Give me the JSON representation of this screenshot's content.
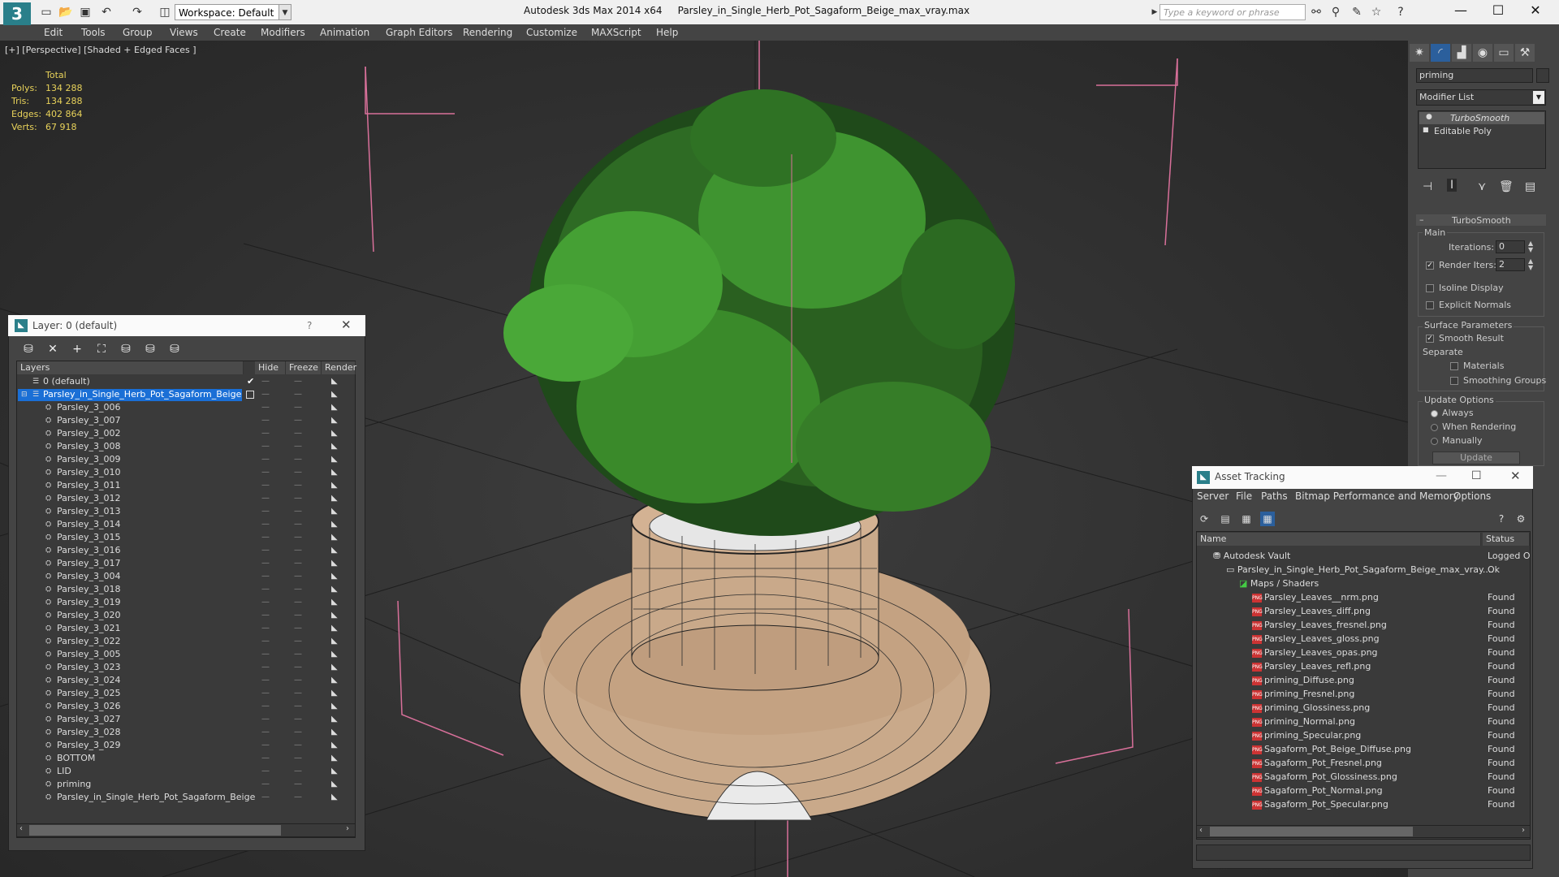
{
  "titlebar": {
    "workspace": "Workspace: Default",
    "app_title": "Autodesk 3ds Max  2014 x64",
    "file_title": "Parsley_in_Single_Herb_Pot_Sagaform_Beige_max_vray.max",
    "search_placeholder": "Type a keyword or phrase"
  },
  "menu": [
    "Edit",
    "Tools",
    "Group",
    "Views",
    "Create",
    "Modifiers",
    "Animation",
    "Graph Editors",
    "Rendering",
    "Customize",
    "MAXScript",
    "Help"
  ],
  "viewport": {
    "label": "[+] [Perspective] [Shaded + Edged Faces ]",
    "stats": {
      "total_label": "Total",
      "rows": [
        {
          "label": "Polys:",
          "value": "134 288"
        },
        {
          "label": "Tris:",
          "value": "134 288"
        },
        {
          "label": "Edges:",
          "value": "402 864"
        },
        {
          "label": "Verts:",
          "value": "67 918"
        }
      ]
    }
  },
  "command_panel": {
    "object_name": "priming",
    "modifier_list": "Modifier List",
    "stack": [
      "TurboSmooth",
      "Editable Poly"
    ],
    "rollout_title": "TurboSmooth",
    "main_label": "Main",
    "iterations_label": "Iterations:",
    "iterations_value": "0",
    "render_iters_label": "Render Iters:",
    "render_iters_value": "2",
    "isoline_label": "Isoline Display",
    "explicit_normals_label": "Explicit Normals",
    "surface_params_label": "Surface Parameters",
    "smooth_result_label": "Smooth Result",
    "separate_label": "Separate",
    "materials_label": "Materials",
    "smoothing_groups_label": "Smoothing Groups",
    "update_options_label": "Update Options",
    "always_label": "Always",
    "when_rendering_label": "When Rendering",
    "manually_label": "Manually",
    "update_button": "Update"
  },
  "layer_window": {
    "title": "Layer: 0 (default)",
    "help": "?",
    "columns": [
      "Layers",
      "Hide",
      "Freeze",
      "Render"
    ],
    "default_layer": "0 (default)",
    "selected_layer": "Parsley_in_Single_Herb_Pot_Sagaform_Beige",
    "objects": [
      "Parsley_3_006",
      "Parsley_3_007",
      "Parsley_3_002",
      "Parsley_3_008",
      "Parsley_3_009",
      "Parsley_3_010",
      "Parsley_3_011",
      "Parsley_3_012",
      "Parsley_3_013",
      "Parsley_3_014",
      "Parsley_3_015",
      "Parsley_3_016",
      "Parsley_3_017",
      "Parsley_3_004",
      "Parsley_3_018",
      "Parsley_3_019",
      "Parsley_3_020",
      "Parsley_3_021",
      "Parsley_3_022",
      "Parsley_3_005",
      "Parsley_3_023",
      "Parsley_3_024",
      "Parsley_3_025",
      "Parsley_3_026",
      "Parsley_3_027",
      "Parsley_3_028",
      "Parsley_3_029",
      "BOTTOM",
      "LID",
      "priming",
      "Parsley_in_Single_Herb_Pot_Sagaform_Beige"
    ]
  },
  "asset_window": {
    "title": "Asset Tracking",
    "menu": [
      "Server",
      "File",
      "Paths",
      "Bitmap Performance and Memory",
      "Options"
    ],
    "columns": [
      "Name",
      "Status"
    ],
    "vault": {
      "name": "Autodesk Vault",
      "status": "Logged O"
    },
    "file": {
      "name": "Parsley_in_Single_Herb_Pot_Sagaform_Beige_max_vray....",
      "status": "Ok"
    },
    "maps_label": "Maps / Shaders",
    "maps": [
      {
        "name": "Parsley_Leaves__nrm.png",
        "status": "Found"
      },
      {
        "name": "Parsley_Leaves_diff.png",
        "status": "Found"
      },
      {
        "name": "Parsley_Leaves_fresnel.png",
        "status": "Found"
      },
      {
        "name": "Parsley_Leaves_gloss.png",
        "status": "Found"
      },
      {
        "name": "Parsley_Leaves_opas.png",
        "status": "Found"
      },
      {
        "name": "Parsley_Leaves_refl.png",
        "status": "Found"
      },
      {
        "name": "priming_Diffuse.png",
        "status": "Found"
      },
      {
        "name": "priming_Fresnel.png",
        "status": "Found"
      },
      {
        "name": "priming_Glossiness.png",
        "status": "Found"
      },
      {
        "name": "priming_Normal.png",
        "status": "Found"
      },
      {
        "name": "priming_Specular.png",
        "status": "Found"
      },
      {
        "name": "Sagaform_Pot_Beige_Diffuse.png",
        "status": "Found"
      },
      {
        "name": "Sagaform_Pot_Fresnel.png",
        "status": "Found"
      },
      {
        "name": "Sagaform_Pot_Glossiness.png",
        "status": "Found"
      },
      {
        "name": "Sagaform_Pot_Normal.png",
        "status": "Found"
      },
      {
        "name": "Sagaform_Pot_Specular.png",
        "status": "Found"
      }
    ]
  },
  "colors": {
    "selection": "#1a6fd6",
    "stat_text": "#e8d25a",
    "leaf": "#3a8a2a",
    "pot": "#c9a98a",
    "guide": "#d8709a"
  }
}
